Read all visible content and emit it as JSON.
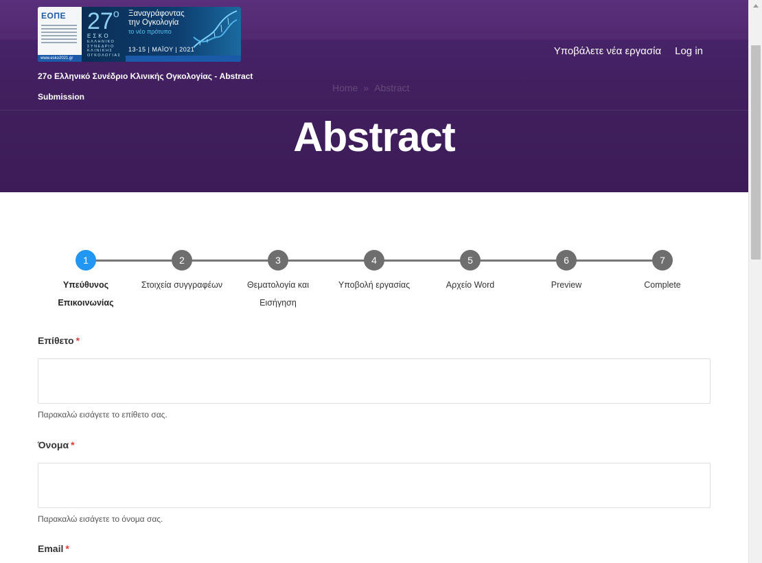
{
  "header": {
    "logo": {
      "eope": "ΕΟΠΕ",
      "number": "27",
      "esko": "ΕΣΚΟ",
      "subtitle_lines": [
        "ΕΛΛΗΝΙΚΟ",
        "ΣΥΝΕΔΡΙΟ",
        "ΚΛΙΝΙΚΗΣ",
        "ΟΓΚΟΛΟΓΙΑΣ"
      ],
      "tagline_line1": "Ξαναγράφοντας",
      "tagline_line2": "την Ογκολογία",
      "tagline_accent": "το νέο πρότυπο",
      "dates": "13-15 | ΜΑΪΟΥ | 2021",
      "url": "www.esko2021.gr"
    },
    "site_title": "27ο Ελληνικό Συνέδριο Κλινικής Ογκολογίας - Abstract Submission",
    "nav": {
      "submit_link": "Υποβάλετε νέα εργασία",
      "login_link": "Log in"
    },
    "breadcrumb": {
      "home": "Home",
      "separator": "»",
      "current": "Abstract"
    },
    "page_title": "Abstract"
  },
  "stepper": {
    "active_step": 1,
    "steps": [
      {
        "number": "1",
        "label": "Υπεύθυνος Επικοινωνίας"
      },
      {
        "number": "2",
        "label": "Στοιχεία συγγραφέων"
      },
      {
        "number": "3",
        "label": "Θεματολογία και Εισήγηση"
      },
      {
        "number": "4",
        "label": "Υποβολή εργασίας"
      },
      {
        "number": "5",
        "label": "Αρχείο Word"
      },
      {
        "number": "6",
        "label": "Preview"
      },
      {
        "number": "7",
        "label": "Complete"
      }
    ]
  },
  "form": {
    "required_mark": "*",
    "surname": {
      "label": "Επίθετο",
      "value": "",
      "help": "Παρακαλώ εισάγετε το επίθετο σας."
    },
    "first_name": {
      "label": "Όνομα",
      "value": "",
      "help": "Παρακαλώ εισάγετε το όνομα σας."
    },
    "email": {
      "label": "Email"
    }
  },
  "colors": {
    "header_bg": "#42205f",
    "active_step": "#2196f3",
    "inactive_step": "#6e6e6e",
    "required": "#e53935"
  }
}
